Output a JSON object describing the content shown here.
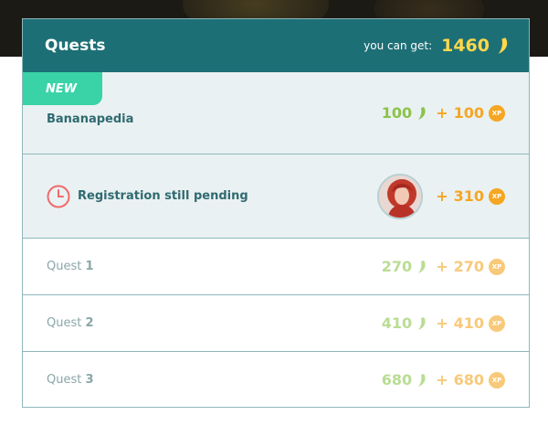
{
  "panel": {
    "title": "Quests",
    "you_can_get_label": "you can get:",
    "total": "1460"
  },
  "first_item": {
    "badge": "NEW",
    "name": "Bananapedia",
    "bananas": "100",
    "plus": "+",
    "xp": "100",
    "xp_label": "XP"
  },
  "pending_item": {
    "name": "Registration still pending",
    "plus": "+",
    "xp": "310",
    "xp_label": "XP"
  },
  "quests": [
    {
      "label": "Quest",
      "num": "1",
      "bananas": "270",
      "plus": "+",
      "xp": "270",
      "xp_label": "XP"
    },
    {
      "label": "Quest",
      "num": "2",
      "bananas": "410",
      "plus": "+",
      "xp": "410",
      "xp_label": "XP"
    },
    {
      "label": "Quest",
      "num": "3",
      "bananas": "680",
      "plus": "+",
      "xp": "680",
      "xp_label": "XP"
    }
  ],
  "colors": {
    "header_bg": "#1d6f76",
    "total_yellow": "#ffd84a",
    "banana_green": "#8bc34a",
    "xp_orange": "#f5a623",
    "new_badge": "#39d3a7"
  },
  "icons": {
    "banana": "banana-icon",
    "xp": "xp-coin-icon",
    "clock": "clock-icon",
    "avatar": "avatar"
  }
}
